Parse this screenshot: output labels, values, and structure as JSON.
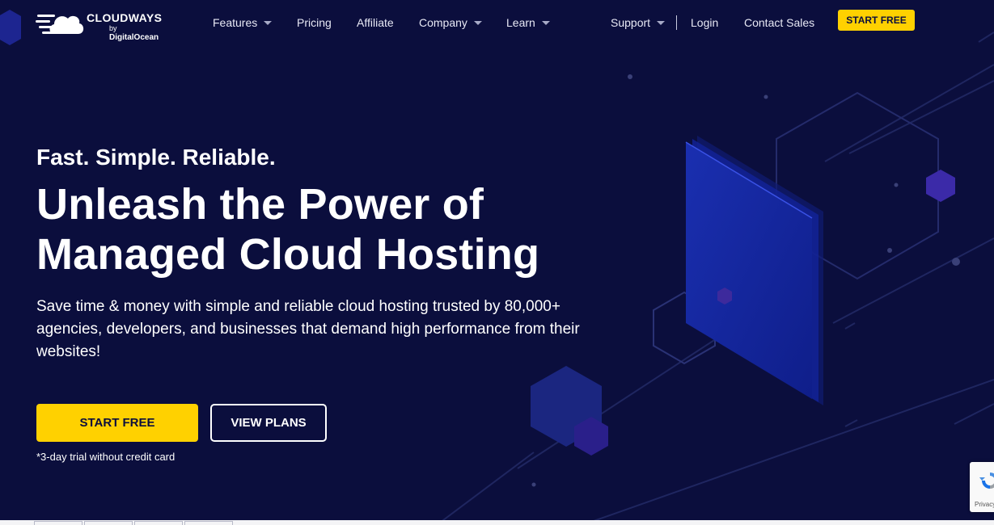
{
  "brand": {
    "name": "CLOUDWAYS",
    "by_prefix": "by",
    "by_company": "DigitalOcean"
  },
  "nav": {
    "items": [
      {
        "label": "Features",
        "has_dropdown": true
      },
      {
        "label": "Pricing",
        "has_dropdown": false
      },
      {
        "label": "Affiliate",
        "has_dropdown": false
      },
      {
        "label": "Company",
        "has_dropdown": true
      },
      {
        "label": "Learn",
        "has_dropdown": true
      }
    ],
    "support": "Support",
    "login": "Login",
    "contact_sales": "Contact Sales",
    "start_free": "START FREE"
  },
  "hero": {
    "tagline": "Fast. Simple. Reliable.",
    "headline_line1": "Unleash the Power of",
    "headline_line2": "Managed Cloud Hosting",
    "subtext": "Save time & money with simple and reliable cloud hosting trusted by 80,000+ agencies, developers, and businesses that demand high performance from their websites!",
    "cta_primary": "START FREE",
    "cta_secondary": "VIEW PLANS",
    "trial_note": "*3-day trial without credit card"
  },
  "recaptcha": {
    "label": "Privacy"
  },
  "colors": {
    "background": "#0b0e3d",
    "accent_yellow": "#ffd100",
    "text_white": "#ffffff"
  }
}
